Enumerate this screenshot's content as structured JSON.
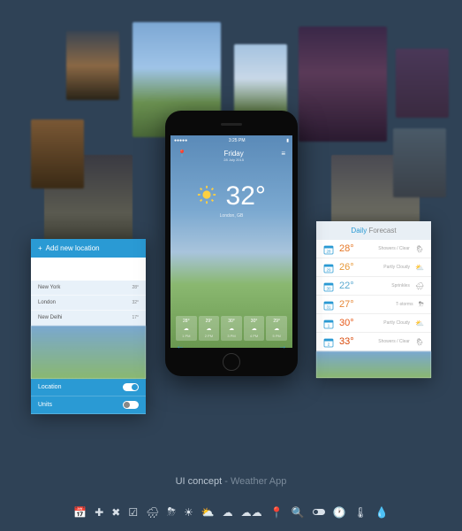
{
  "phone": {
    "status": {
      "carrier": "●●●●●",
      "time": "3:25 PM",
      "battery": "▮"
    },
    "header": {
      "day": "Friday",
      "date": "28 July 2015"
    },
    "main": {
      "temperature": "32°",
      "city": "London, GB"
    },
    "hourly": [
      {
        "temp": "28°",
        "time": "1 PM"
      },
      {
        "temp": "29°",
        "time": "2 PM"
      },
      {
        "temp": "30°",
        "time": "3 PM"
      },
      {
        "temp": "30°",
        "time": "4 PM"
      },
      {
        "temp": "29°",
        "time": "5 PM"
      }
    ]
  },
  "locations": {
    "add_label": "Add new location",
    "search_placeholder": "",
    "items": [
      {
        "name": "New York",
        "temp": "28°"
      },
      {
        "name": "London",
        "temp": "32°"
      },
      {
        "name": "New Delhi",
        "temp": "17°"
      }
    ],
    "settings": {
      "location": "Location",
      "units": "Units"
    }
  },
  "daily": {
    "title": "Daily",
    "title2": "Forecast",
    "items": [
      {
        "date": "28",
        "temp": "28°",
        "cond": "Showers / Clear",
        "temp_color": "#e67828"
      },
      {
        "date": "29",
        "temp": "26°",
        "cond": "Partly Cloudy",
        "temp_color": "#e69838"
      },
      {
        "date": "30",
        "temp": "22°",
        "cond": "Sprinkles",
        "temp_color": "#58a8d0"
      },
      {
        "date": "31",
        "temp": "27°",
        "cond": "T-storms",
        "temp_color": "#e68838"
      },
      {
        "date": "1",
        "temp": "30°",
        "cond": "Partly Cloudy",
        "temp_color": "#e65818"
      },
      {
        "date": "2",
        "temp": "33°",
        "cond": "Showers / Clear",
        "temp_color": "#d84808"
      }
    ]
  },
  "footer": {
    "title": "UI concept",
    "subtitle": " - Weather App"
  },
  "icon_names": [
    "calendar-icon",
    "add-icon",
    "close-icon",
    "checkbox-icon",
    "rain-cloud-icon",
    "storm-icon",
    "sun-icon",
    "partly-cloudy-icon",
    "cloud-icon",
    "clouds-icon",
    "pin-icon",
    "search-icon",
    "toggle-icon",
    "clock-icon",
    "thermometer-icon",
    "drop-icon"
  ]
}
